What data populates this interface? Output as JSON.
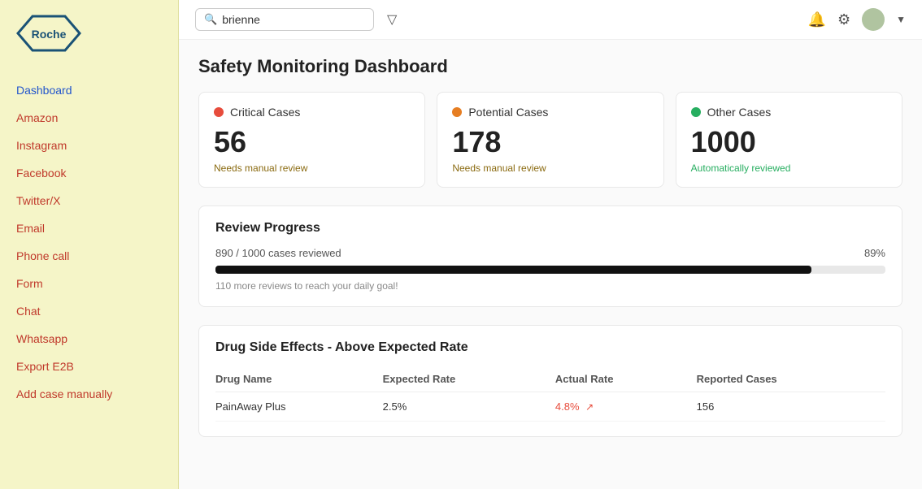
{
  "sidebar": {
    "logo_text": "Roche",
    "items": [
      {
        "label": "Dashboard",
        "active": true,
        "id": "dashboard"
      },
      {
        "label": "Amazon",
        "active": false,
        "id": "amazon"
      },
      {
        "label": "Instagram",
        "active": false,
        "id": "instagram"
      },
      {
        "label": "Facebook",
        "active": false,
        "id": "facebook"
      },
      {
        "label": "Twitter/X",
        "active": false,
        "id": "twitter"
      },
      {
        "label": "Email",
        "active": false,
        "id": "email"
      },
      {
        "label": "Phone call",
        "active": false,
        "id": "phone-call"
      },
      {
        "label": "Form",
        "active": false,
        "id": "form"
      },
      {
        "label": "Chat",
        "active": false,
        "id": "chat"
      },
      {
        "label": "Whatsapp",
        "active": false,
        "id": "whatsapp"
      },
      {
        "label": "Export E2B",
        "active": false,
        "id": "export-e2b"
      },
      {
        "label": "Add case manually",
        "active": false,
        "id": "add-case"
      }
    ]
  },
  "header": {
    "search_value": "brienne",
    "search_placeholder": "Search...",
    "filter_icon": "▽",
    "bell_icon": "🔔",
    "gear_icon": "⚙"
  },
  "page": {
    "title": "Safety Monitoring Dashboard"
  },
  "cards": [
    {
      "id": "critical",
      "dot_color": "red",
      "label": "Critical Cases",
      "number": "56",
      "sub": "Needs manual review",
      "sub_color": "amber"
    },
    {
      "id": "potential",
      "dot_color": "orange",
      "label": "Potential Cases",
      "number": "178",
      "sub": "Needs manual review",
      "sub_color": "amber"
    },
    {
      "id": "other",
      "dot_color": "green",
      "label": "Other Cases",
      "number": "1000",
      "sub": "Automatically reviewed",
      "sub_color": "green"
    }
  ],
  "review_progress": {
    "title": "Review Progress",
    "reviewed": 890,
    "total": 1000,
    "label": "890 / 1000 cases reviewed",
    "percent": 89,
    "percent_label": "89%",
    "fill_width": "89%",
    "note": "110 more reviews to reach your daily goal!"
  },
  "drug_table": {
    "title": "Drug Side Effects - Above Expected Rate",
    "columns": [
      "Drug Name",
      "Expected Rate",
      "Actual Rate",
      "Reported Cases"
    ],
    "rows": [
      {
        "drug_name": "PainAway Plus",
        "expected_rate": "2.5%",
        "actual_rate": "4.8%",
        "actual_rate_color": "red",
        "trend": "↗",
        "reported_cases": "156"
      }
    ]
  }
}
